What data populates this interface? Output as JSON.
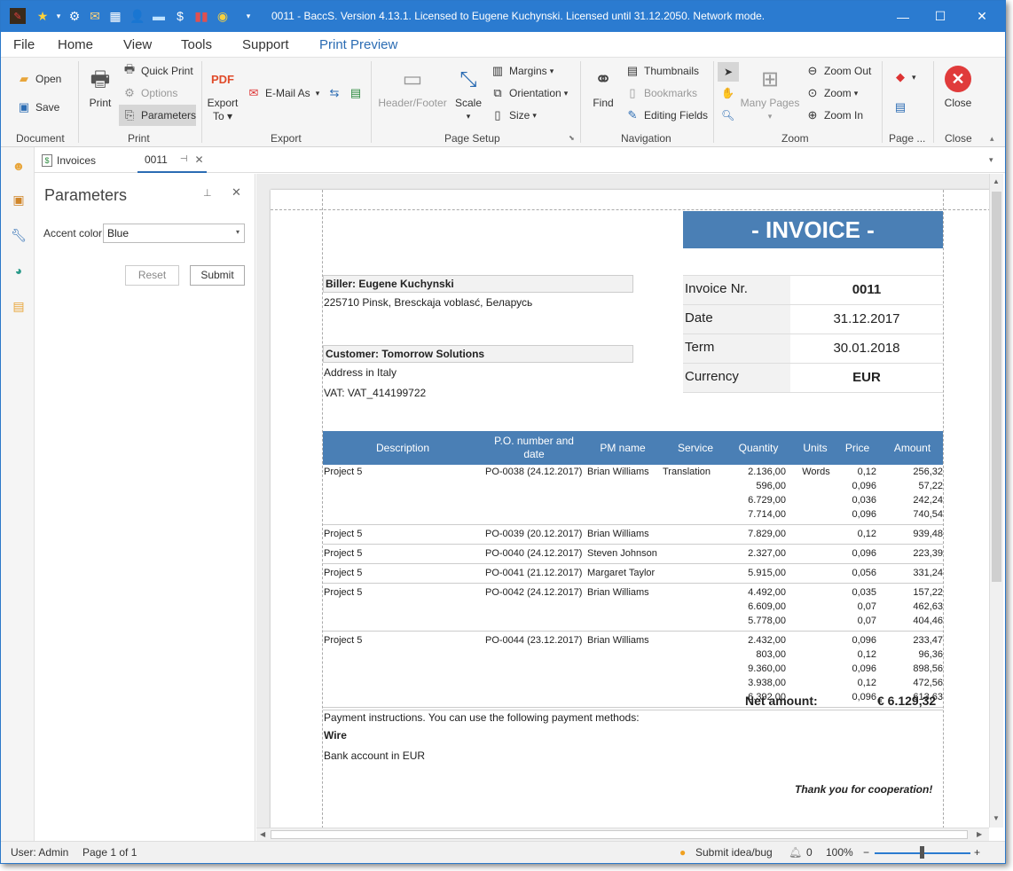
{
  "titlebar": {
    "title": "0011 - BaccS. Version 4.13.1. Licensed to Eugene Kuchynski. Licensed until 31.12.2050. Network mode.",
    "minimize": "—",
    "maximize": "☐",
    "close": "✕"
  },
  "menu": [
    "File",
    "Home",
    "View",
    "Tools",
    "Support",
    "Print Preview"
  ],
  "ribbon": {
    "document": {
      "open": "Open",
      "save": "Save",
      "label": "Document"
    },
    "print": {
      "print": "Print",
      "quick_print": "Quick Print",
      "options": "Options",
      "parameters": "Parameters",
      "label": "Print"
    },
    "export": {
      "export_to_1": "Export",
      "export_to_2": "To",
      "email_as": "E-Mail As",
      "label": "Export"
    },
    "page_setup": {
      "header_footer": "Header/Footer",
      "scale": "Scale",
      "margins": "Margins",
      "orientation": "Orientation",
      "size": "Size",
      "label": "Page Setup"
    },
    "navigation": {
      "find": "Find",
      "thumbnails": "Thumbnails",
      "bookmarks": "Bookmarks",
      "editing_fields": "Editing Fields",
      "label": "Navigation"
    },
    "zoom": {
      "many_pages": "Many Pages",
      "zoom_out": "Zoom Out",
      "zoom": "Zoom",
      "zoom_in": "Zoom In",
      "label": "Zoom"
    },
    "page": {
      "label": "Page ..."
    },
    "close": {
      "close": "Close",
      "label": "Close"
    }
  },
  "tabs": [
    {
      "label": "Invoices"
    },
    {
      "label": "0011"
    }
  ],
  "params": {
    "title": "Parameters",
    "accent_label": "Accent color",
    "accent_value": "Blue",
    "reset": "Reset",
    "submit": "Submit"
  },
  "invoice": {
    "title": "- INVOICE -",
    "biller": "Biller: Eugene Kuchynski",
    "biller_address": "225710 Pinsk, Bresckaja voblasć, Беларусь",
    "customer": "Customer: Tomorrow Solutions",
    "customer_address": "Address in Italy",
    "vat": "VAT: VAT_414199722",
    "meta": [
      {
        "label": "Invoice Nr.",
        "value": "0011"
      },
      {
        "label": "Date",
        "value": "31.12.2017"
      },
      {
        "label": "Term",
        "value": "30.01.2018"
      },
      {
        "label": "Currency",
        "value": "EUR"
      }
    ],
    "columns": [
      "Description",
      "P.O. number and date",
      "PM name",
      "Service",
      "Quantity",
      "Units",
      "Price",
      "Amount"
    ],
    "rows": [
      {
        "desc": "Project 5",
        "po": "PO-0038 (24.12.2017)",
        "pm": "Brian Williams",
        "service": "Translation",
        "units": "Words",
        "lines": [
          [
            "2.136,00",
            "0,12",
            "256,32"
          ],
          [
            "596,00",
            "0,096",
            "57,22"
          ],
          [
            "6.729,00",
            "0,036",
            "242,24"
          ],
          [
            "7.714,00",
            "0,096",
            "740,54"
          ]
        ]
      },
      {
        "desc": "Project 5",
        "po": "PO-0039 (20.12.2017)",
        "pm": "Brian Williams",
        "service": "",
        "units": "",
        "lines": [
          [
            "7.829,00",
            "0,12",
            "939,48"
          ]
        ]
      },
      {
        "desc": "Project 5",
        "po": "PO-0040 (24.12.2017)",
        "pm": "Steven Johnson",
        "service": "",
        "units": "",
        "lines": [
          [
            "2.327,00",
            "0,096",
            "223,39"
          ]
        ]
      },
      {
        "desc": "Project 5",
        "po": "PO-0041 (21.12.2017)",
        "pm": "Margaret Taylor",
        "service": "",
        "units": "",
        "lines": [
          [
            "5.915,00",
            "0,056",
            "331,24"
          ]
        ]
      },
      {
        "desc": "Project 5",
        "po": "PO-0042 (24.12.2017)",
        "pm": "Brian Williams",
        "service": "",
        "units": "",
        "lines": [
          [
            "4.492,00",
            "0,035",
            "157,22"
          ],
          [
            "6.609,00",
            "0,07",
            "462,63"
          ],
          [
            "5.778,00",
            "0,07",
            "404,46"
          ]
        ]
      },
      {
        "desc": "Project 5",
        "po": "PO-0044 (23.12.2017)",
        "pm": "Brian Williams",
        "service": "",
        "units": "",
        "lines": [
          [
            "2.432,00",
            "0,096",
            "233,47"
          ],
          [
            "803,00",
            "0,12",
            "96,36"
          ],
          [
            "9.360,00",
            "0,096",
            "898,56"
          ],
          [
            "3.938,00",
            "0,12",
            "472,56"
          ],
          [
            "6.392,00",
            "0,096",
            "613,63"
          ]
        ]
      }
    ],
    "net_label": "Net amount:",
    "net_value": "€ 6.129,32",
    "payment_text": "Payment instructions. You can use the following payment methods:",
    "wire": "Wire",
    "bank": "Bank account in EUR",
    "thanks": "Thank you for cooperation!"
  },
  "status": {
    "user": "User: Admin",
    "page": "Page 1 of 1",
    "idea": "Submit idea/bug",
    "count": "0",
    "zoom": "100%"
  },
  "colors": {
    "accent": "#2b7bd0",
    "invoice_blue": "#4a7fb5"
  }
}
